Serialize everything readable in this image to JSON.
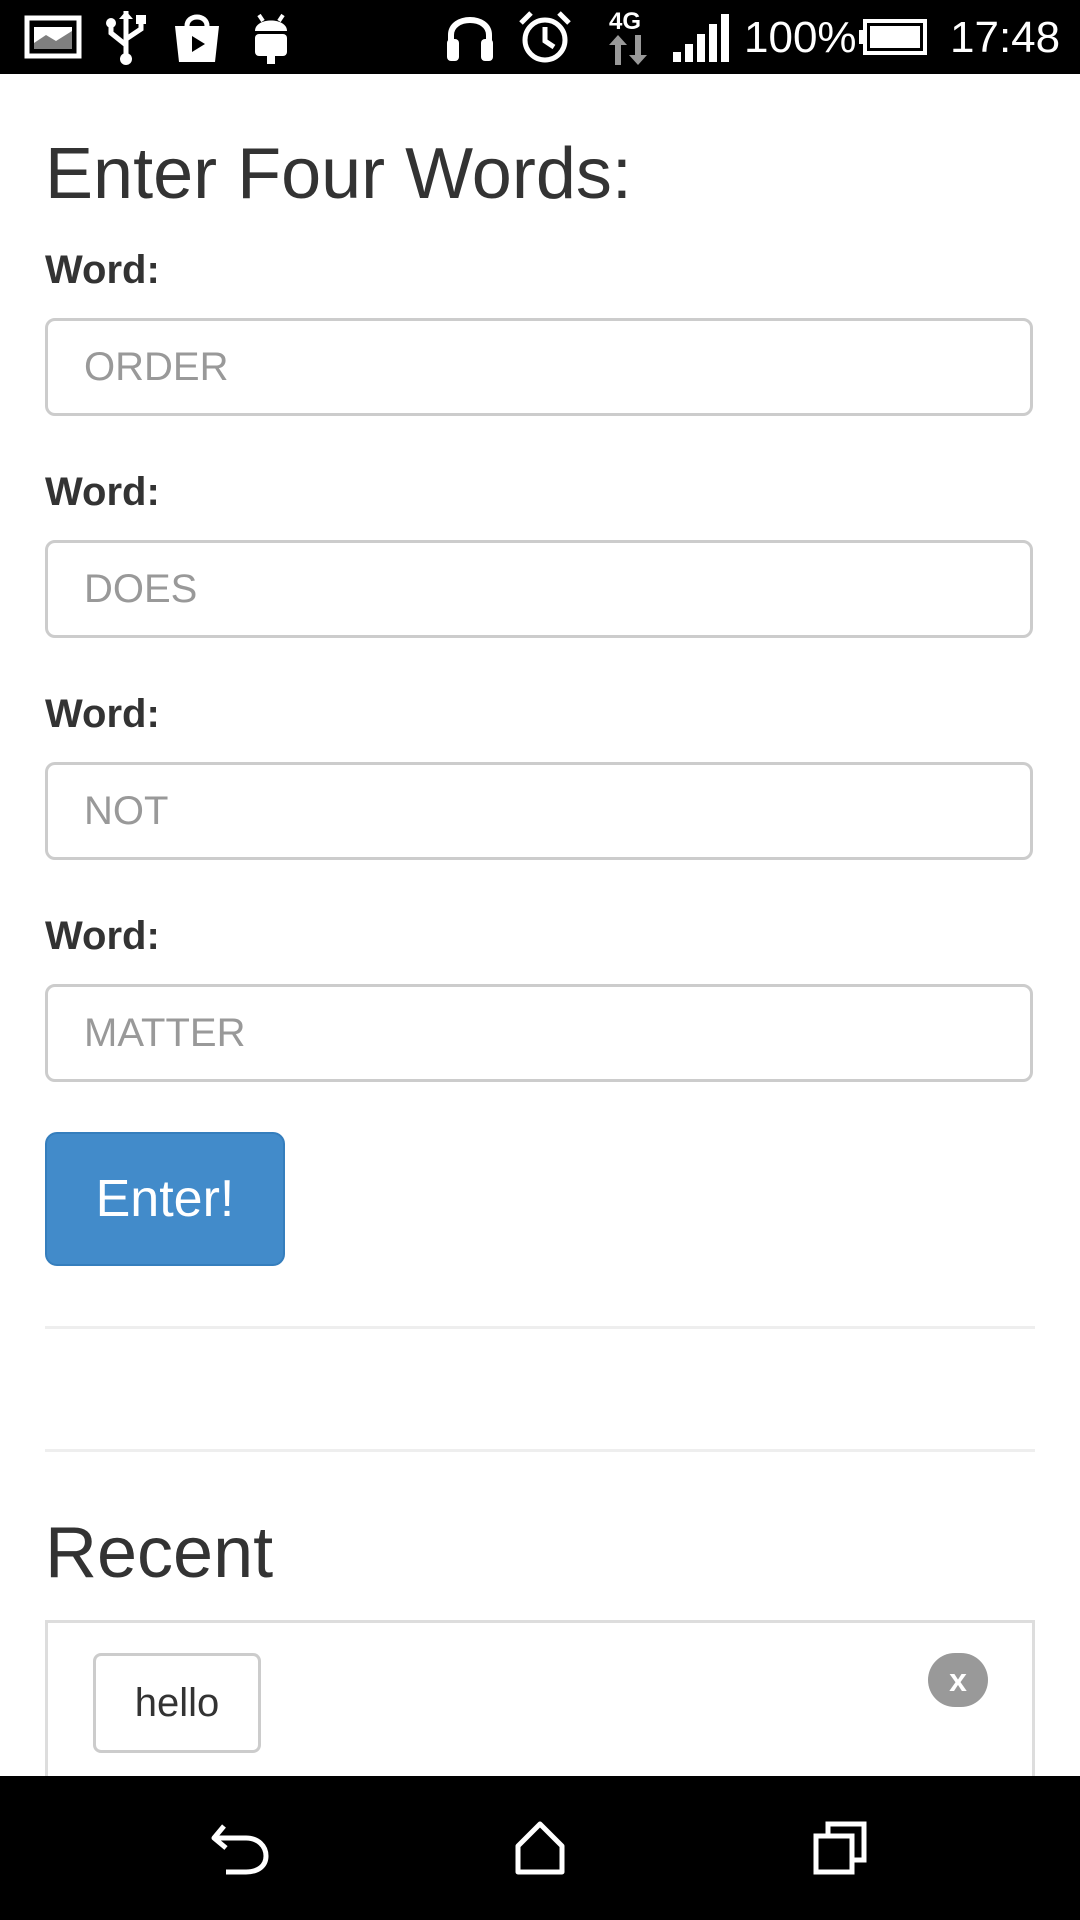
{
  "status_bar": {
    "battery_percent": "100%",
    "time": "17:48",
    "network": "4G",
    "icons": [
      "gallery-icon",
      "usb-icon",
      "store-icon",
      "android-icon",
      "headset-icon",
      "alarm-icon",
      "network-4g-icon",
      "signal-icon",
      "battery-icon"
    ]
  },
  "form": {
    "title": "Enter Four Words:",
    "fields": [
      {
        "label": "Word:",
        "placeholder": "ORDER"
      },
      {
        "label": "Word:",
        "placeholder": "DOES"
      },
      {
        "label": "Word:",
        "placeholder": "NOT"
      },
      {
        "label": "Word:",
        "placeholder": "MATTER"
      }
    ],
    "submit_label": "Enter!",
    "accent_color": "#428bca"
  },
  "recent": {
    "title": "Recent",
    "items": [
      {
        "word": "hello",
        "remove_label": "x"
      }
    ]
  },
  "nav_bar": {
    "icons": [
      "back-icon",
      "home-icon",
      "recents-icon"
    ]
  }
}
